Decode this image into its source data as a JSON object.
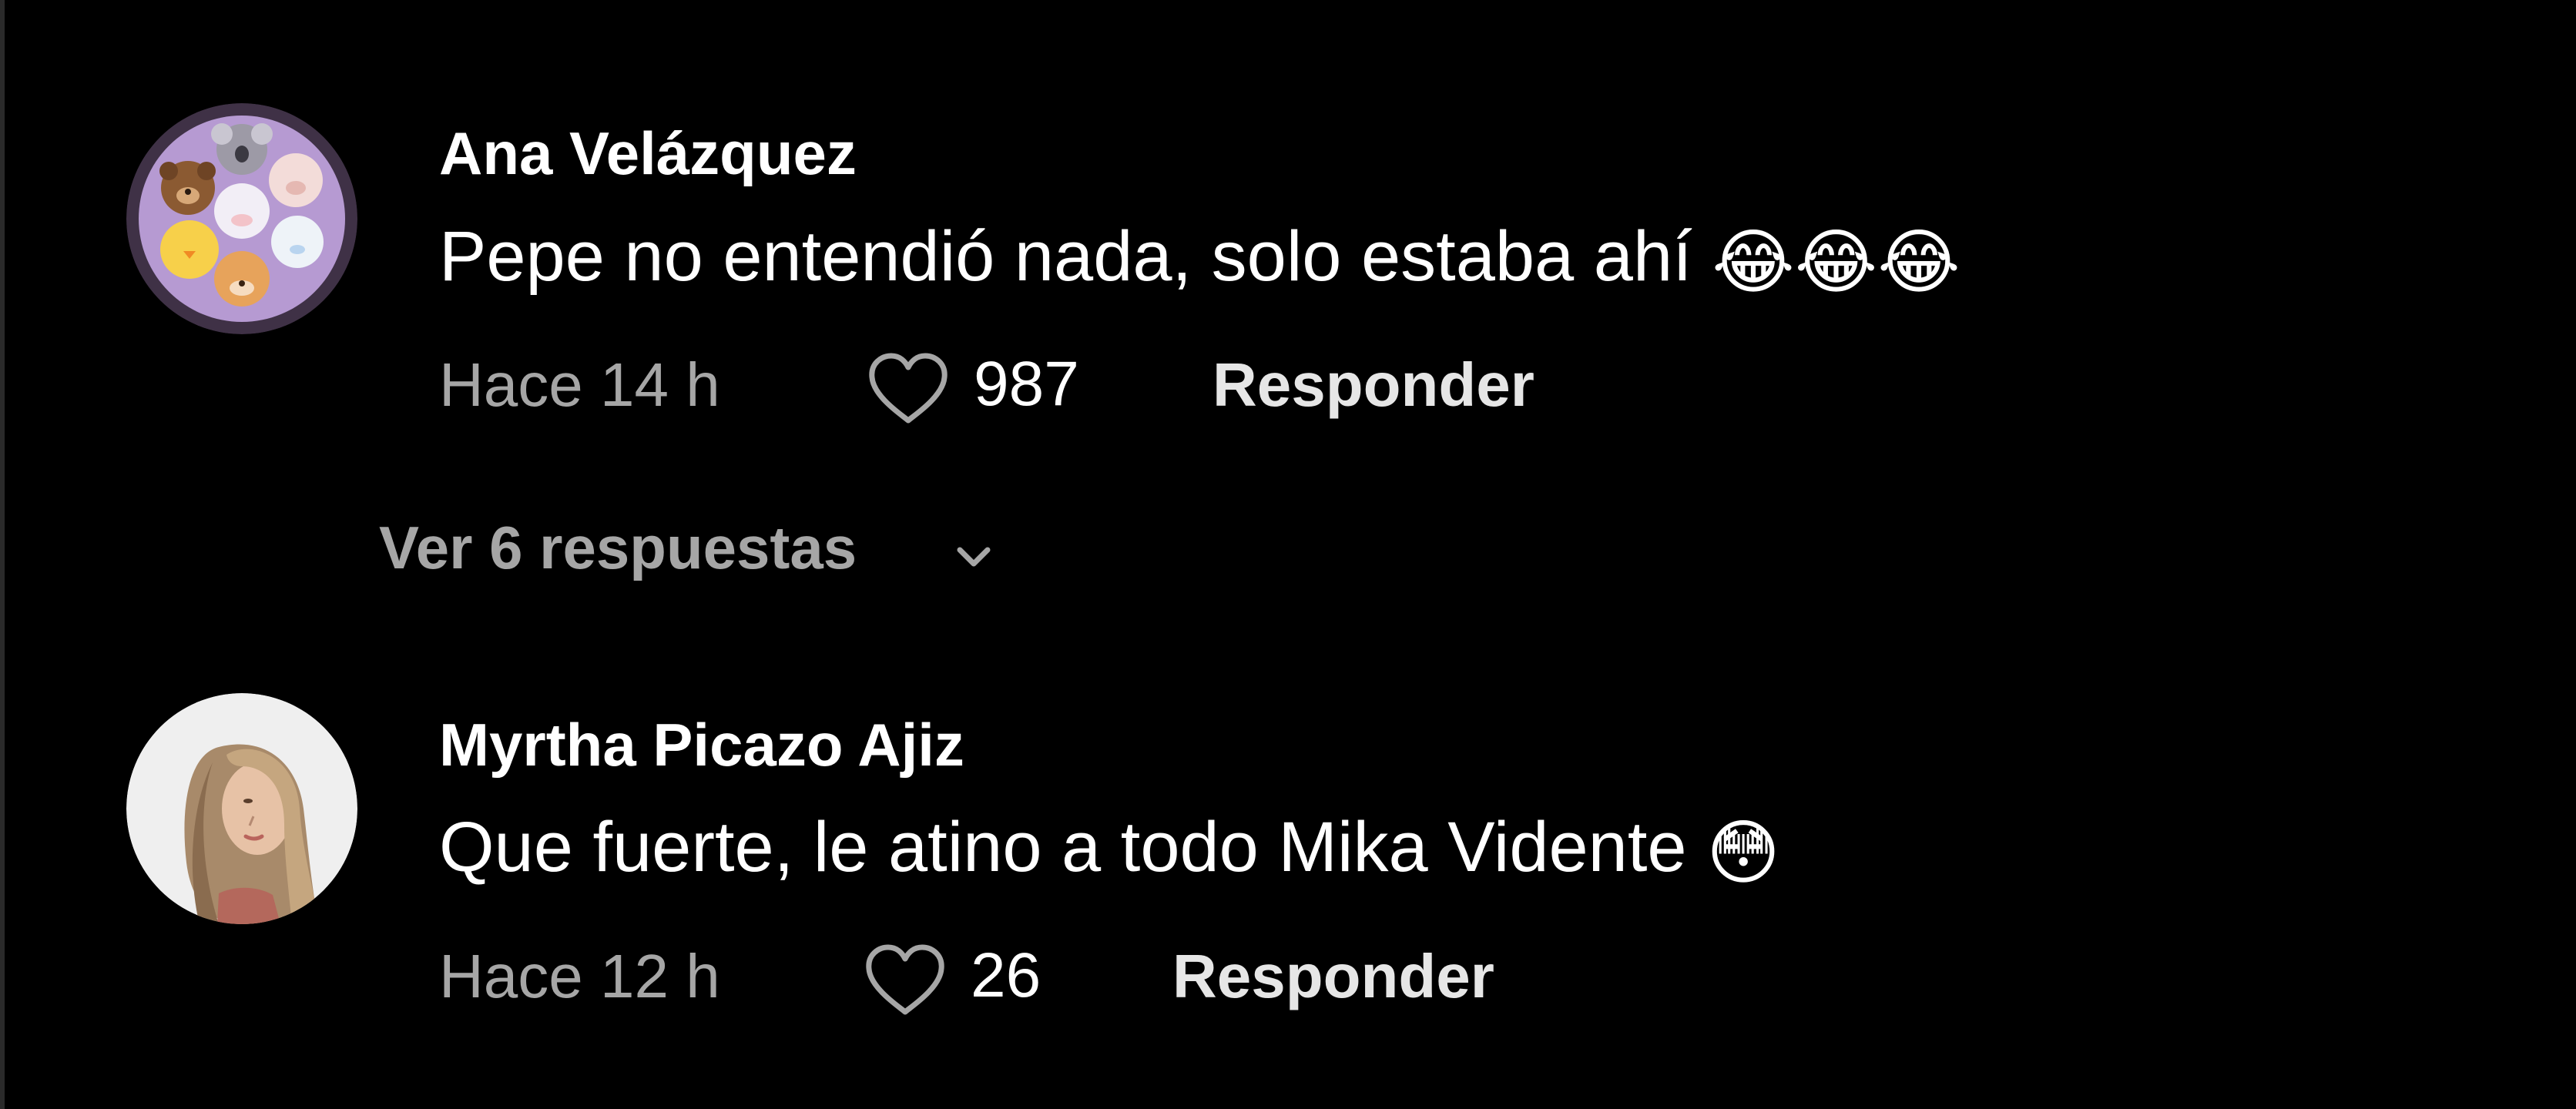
{
  "comments": [
    {
      "username": "Ana Velázquez",
      "text": "Pepe no entendió nada, solo estaba ahí",
      "emoji": "😂😂😂",
      "time": "Hace 14 h",
      "likes": "987",
      "reply_label": "Responder",
      "avatar": "animal-faces-avatar"
    },
    {
      "username": "Myrtha Picazo Ajiz",
      "text": "Que fuerte, le atino a todo Mika Vidente",
      "emoji": "😳",
      "time": "Hace 12 h",
      "likes": "26",
      "reply_label": "Responder",
      "avatar": "woman-photo-avatar"
    }
  ],
  "view_replies": {
    "label": "Ver 6 respuestas"
  },
  "colors": {
    "background": "#000000",
    "primary_text": "#ffffff",
    "secondary_text": "#a6a6a6",
    "avatar_purple": "#b89ad0"
  }
}
